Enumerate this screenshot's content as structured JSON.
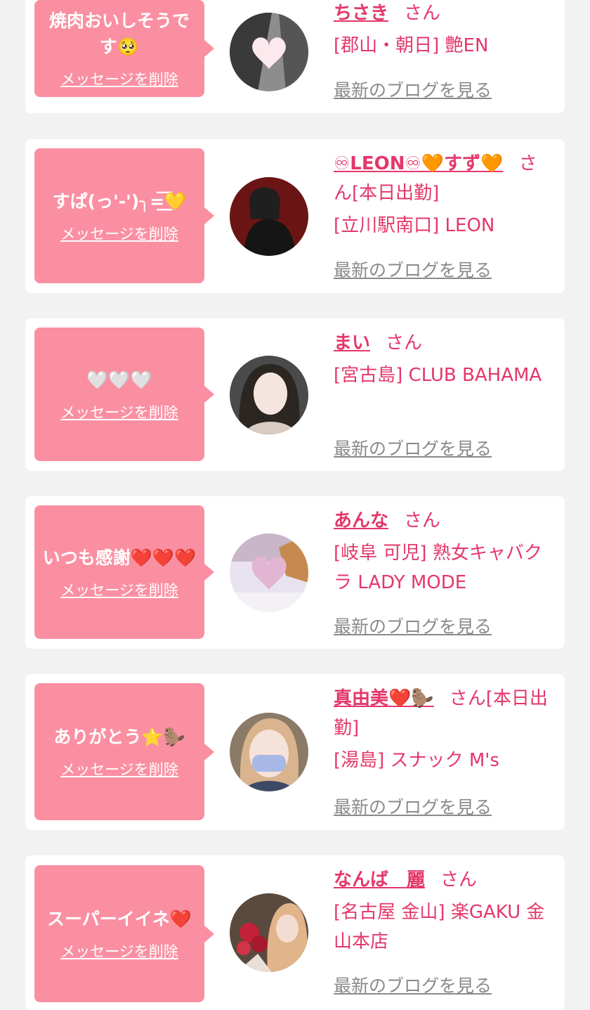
{
  "common": {
    "delete_label": "メッセージを削除",
    "san": "さん",
    "blog_label": "最新のブログを見る"
  },
  "colors": {
    "background": "#f2f2f2",
    "bubble": "#fb8fa2",
    "accent": "#e4376b",
    "link_gray": "#8a8a8a"
  },
  "messages": [
    {
      "message": "焼肉おいしそうです🥺",
      "name": "ちさき",
      "status": "",
      "shop": "[郡山・朝日] 艶EN",
      "avatar": "girl-photo-heart-sticker"
    },
    {
      "message": "すぱ(っ'-')╮=͟͟͞͞💛",
      "name": "♾LEON♾🧡すず🧡",
      "status": "[本日出勤]",
      "shop": "[立川駅南口] LEON",
      "avatar": "girl-photo-black-dress"
    },
    {
      "message": "🤍🤍🤍",
      "name": "まい",
      "status": "",
      "shop": "[宮古島] CLUB BAHAMA",
      "avatar": "girl-photo-portrait"
    },
    {
      "message": "いつも感謝❤️❤️❤️",
      "name": "あんな",
      "status": "",
      "shop": "[岐阜 可児] 熟女キャバクラ LADY MODE",
      "avatar": "heart-glass-photo"
    },
    {
      "message": "ありがとう⭐️🦫",
      "name": "真由美❤️🦫",
      "status": "[本日出勤]",
      "shop": "[湯島] スナック M's",
      "avatar": "girl-photo-mask"
    },
    {
      "message": "スーパーイイネ❤️",
      "name": "なんば　麗",
      "status": "",
      "shop": "[名古屋 金山] 楽GAKU 金山本店",
      "avatar": "girl-photo-roses"
    }
  ]
}
